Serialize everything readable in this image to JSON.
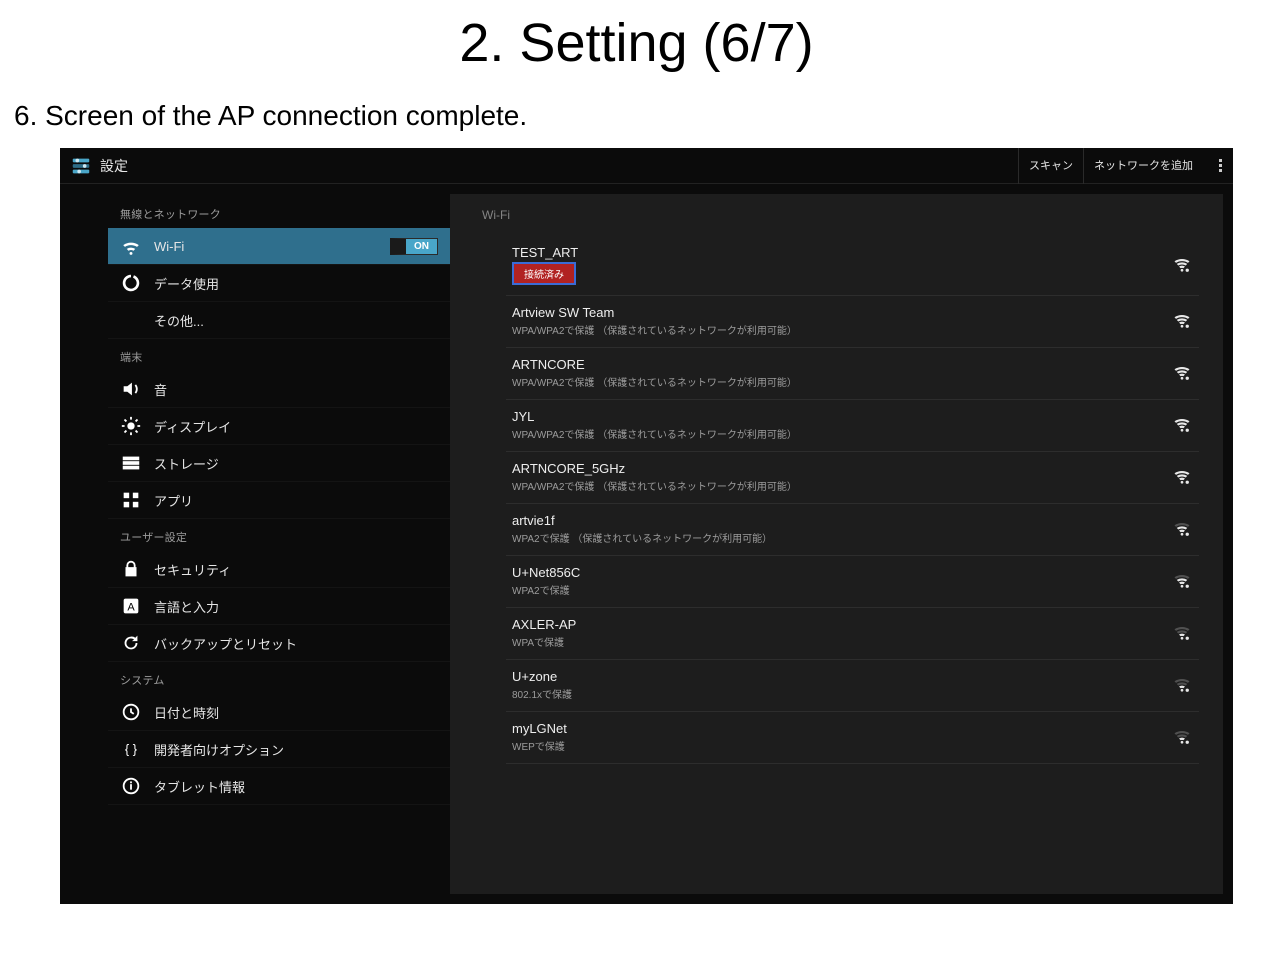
{
  "page": {
    "title": "2. Setting (6/7)",
    "caption": "6. Screen of the AP connection complete."
  },
  "topbar": {
    "title": "設定",
    "actions": {
      "scan": "スキャン",
      "add": "ネットワークを追加"
    }
  },
  "sidebar": {
    "section_wireless": "無線とネットワーク",
    "wifi": {
      "label": "Wi-Fi",
      "toggle": "ON"
    },
    "data_usage": "データ使用",
    "more": "その他...",
    "section_device": "端末",
    "sound": "音",
    "display": "ディスプレイ",
    "storage": "ストレージ",
    "apps": "アプリ",
    "section_user": "ユーザー設定",
    "security": "セキュリティ",
    "language": "言語と入力",
    "backup": "バックアップとリセット",
    "section_system": "システム",
    "datetime": "日付と時刻",
    "developer": "開発者向けオプション",
    "about": "タブレット情報"
  },
  "content": {
    "header": "Wi-Fi",
    "networks": [
      {
        "name": "TEST_ART",
        "sub": "",
        "badge": "接続済み",
        "lock": true,
        "strength": 3
      },
      {
        "name": "Artview SW Team",
        "sub": "WPA/WPA2で保護 （保護されているネットワークが利用可能）",
        "lock": true,
        "strength": 3
      },
      {
        "name": "ARTNCORE",
        "sub": "WPA/WPA2で保護 （保護されているネットワークが利用可能）",
        "lock": true,
        "strength": 3
      },
      {
        "name": "JYL",
        "sub": "WPA/WPA2で保護 （保護されているネットワークが利用可能）",
        "lock": true,
        "strength": 3
      },
      {
        "name": "ARTNCORE_5GHz",
        "sub": "WPA/WPA2で保護 （保護されているネットワークが利用可能）",
        "lock": true,
        "strength": 3
      },
      {
        "name": "artvie1f",
        "sub": "WPA2で保護 （保護されているネットワークが利用可能）",
        "lock": true,
        "strength": 2
      },
      {
        "name": "U+Net856C",
        "sub": "WPA2で保護",
        "lock": true,
        "strength": 2
      },
      {
        "name": "AXLER-AP",
        "sub": "WPAで保護",
        "lock": true,
        "strength": 1
      },
      {
        "name": "U+zone",
        "sub": "802.1xで保護",
        "lock": true,
        "strength": 1
      },
      {
        "name": "myLGNet",
        "sub": "WEPで保護",
        "lock": true,
        "strength": 1
      }
    ]
  }
}
